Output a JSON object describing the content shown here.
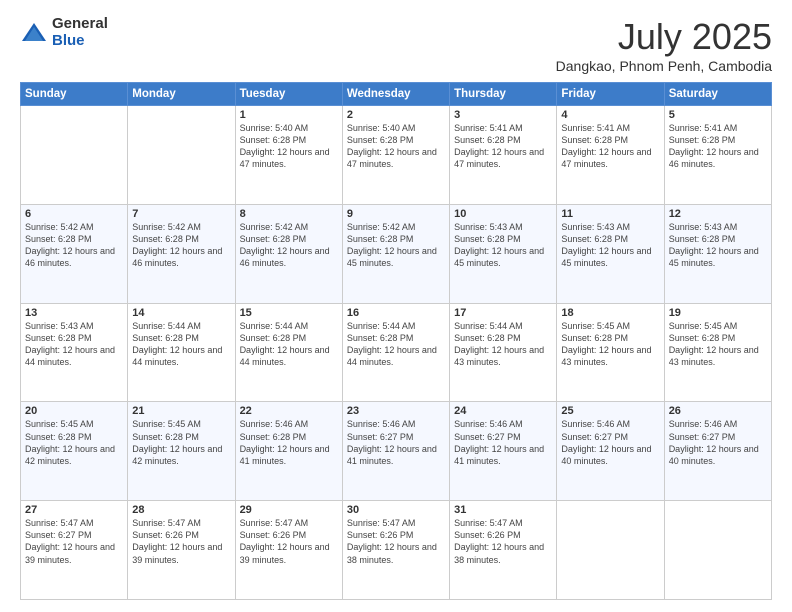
{
  "logo": {
    "general": "General",
    "blue": "Blue"
  },
  "title": "July 2025",
  "subtitle": "Dangkao, Phnom Penh, Cambodia",
  "days_header": [
    "Sunday",
    "Monday",
    "Tuesday",
    "Wednesday",
    "Thursday",
    "Friday",
    "Saturday"
  ],
  "weeks": [
    [
      {
        "day": "",
        "info": ""
      },
      {
        "day": "",
        "info": ""
      },
      {
        "day": "1",
        "info": "Sunrise: 5:40 AM\nSunset: 6:28 PM\nDaylight: 12 hours and 47 minutes."
      },
      {
        "day": "2",
        "info": "Sunrise: 5:40 AM\nSunset: 6:28 PM\nDaylight: 12 hours and 47 minutes."
      },
      {
        "day": "3",
        "info": "Sunrise: 5:41 AM\nSunset: 6:28 PM\nDaylight: 12 hours and 47 minutes."
      },
      {
        "day": "4",
        "info": "Sunrise: 5:41 AM\nSunset: 6:28 PM\nDaylight: 12 hours and 47 minutes."
      },
      {
        "day": "5",
        "info": "Sunrise: 5:41 AM\nSunset: 6:28 PM\nDaylight: 12 hours and 46 minutes."
      }
    ],
    [
      {
        "day": "6",
        "info": "Sunrise: 5:42 AM\nSunset: 6:28 PM\nDaylight: 12 hours and 46 minutes."
      },
      {
        "day": "7",
        "info": "Sunrise: 5:42 AM\nSunset: 6:28 PM\nDaylight: 12 hours and 46 minutes."
      },
      {
        "day": "8",
        "info": "Sunrise: 5:42 AM\nSunset: 6:28 PM\nDaylight: 12 hours and 46 minutes."
      },
      {
        "day": "9",
        "info": "Sunrise: 5:42 AM\nSunset: 6:28 PM\nDaylight: 12 hours and 45 minutes."
      },
      {
        "day": "10",
        "info": "Sunrise: 5:43 AM\nSunset: 6:28 PM\nDaylight: 12 hours and 45 minutes."
      },
      {
        "day": "11",
        "info": "Sunrise: 5:43 AM\nSunset: 6:28 PM\nDaylight: 12 hours and 45 minutes."
      },
      {
        "day": "12",
        "info": "Sunrise: 5:43 AM\nSunset: 6:28 PM\nDaylight: 12 hours and 45 minutes."
      }
    ],
    [
      {
        "day": "13",
        "info": "Sunrise: 5:43 AM\nSunset: 6:28 PM\nDaylight: 12 hours and 44 minutes."
      },
      {
        "day": "14",
        "info": "Sunrise: 5:44 AM\nSunset: 6:28 PM\nDaylight: 12 hours and 44 minutes."
      },
      {
        "day": "15",
        "info": "Sunrise: 5:44 AM\nSunset: 6:28 PM\nDaylight: 12 hours and 44 minutes."
      },
      {
        "day": "16",
        "info": "Sunrise: 5:44 AM\nSunset: 6:28 PM\nDaylight: 12 hours and 44 minutes."
      },
      {
        "day": "17",
        "info": "Sunrise: 5:44 AM\nSunset: 6:28 PM\nDaylight: 12 hours and 43 minutes."
      },
      {
        "day": "18",
        "info": "Sunrise: 5:45 AM\nSunset: 6:28 PM\nDaylight: 12 hours and 43 minutes."
      },
      {
        "day": "19",
        "info": "Sunrise: 5:45 AM\nSunset: 6:28 PM\nDaylight: 12 hours and 43 minutes."
      }
    ],
    [
      {
        "day": "20",
        "info": "Sunrise: 5:45 AM\nSunset: 6:28 PM\nDaylight: 12 hours and 42 minutes."
      },
      {
        "day": "21",
        "info": "Sunrise: 5:45 AM\nSunset: 6:28 PM\nDaylight: 12 hours and 42 minutes."
      },
      {
        "day": "22",
        "info": "Sunrise: 5:46 AM\nSunset: 6:28 PM\nDaylight: 12 hours and 41 minutes."
      },
      {
        "day": "23",
        "info": "Sunrise: 5:46 AM\nSunset: 6:27 PM\nDaylight: 12 hours and 41 minutes."
      },
      {
        "day": "24",
        "info": "Sunrise: 5:46 AM\nSunset: 6:27 PM\nDaylight: 12 hours and 41 minutes."
      },
      {
        "day": "25",
        "info": "Sunrise: 5:46 AM\nSunset: 6:27 PM\nDaylight: 12 hours and 40 minutes."
      },
      {
        "day": "26",
        "info": "Sunrise: 5:46 AM\nSunset: 6:27 PM\nDaylight: 12 hours and 40 minutes."
      }
    ],
    [
      {
        "day": "27",
        "info": "Sunrise: 5:47 AM\nSunset: 6:27 PM\nDaylight: 12 hours and 39 minutes."
      },
      {
        "day": "28",
        "info": "Sunrise: 5:47 AM\nSunset: 6:26 PM\nDaylight: 12 hours and 39 minutes."
      },
      {
        "day": "29",
        "info": "Sunrise: 5:47 AM\nSunset: 6:26 PM\nDaylight: 12 hours and 39 minutes."
      },
      {
        "day": "30",
        "info": "Sunrise: 5:47 AM\nSunset: 6:26 PM\nDaylight: 12 hours and 38 minutes."
      },
      {
        "day": "31",
        "info": "Sunrise: 5:47 AM\nSunset: 6:26 PM\nDaylight: 12 hours and 38 minutes."
      },
      {
        "day": "",
        "info": ""
      },
      {
        "day": "",
        "info": ""
      }
    ]
  ]
}
